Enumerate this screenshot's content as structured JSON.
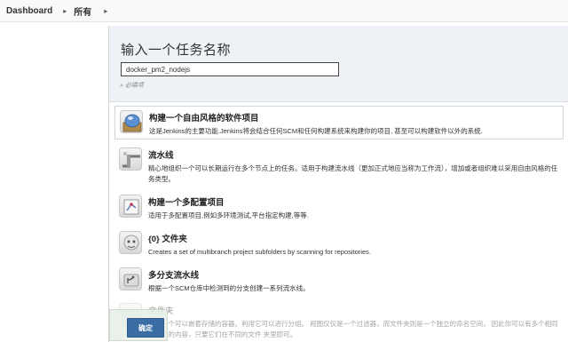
{
  "breadcrumb": {
    "items": [
      "Dashboard",
      "所有"
    ]
  },
  "form": {
    "title": "输入一个任务名称",
    "name_value": "docker_pm2_nodejs",
    "required_hint": "» 必填项"
  },
  "items": [
    {
      "title": "构建一个自由风格的软件项目",
      "desc": "这是Jenkins的主要功能.Jenkins将会结合任何SCM和任何构建系统来构建你的项目, 甚至可以构建软件以外的系统.",
      "icon": "freestyle-project-icon"
    },
    {
      "title": "流水线",
      "desc": "精心地组织一个可以长期运行在多个节点上的任务。适用于构建流水线（更加正式地应当称为工作流），增加或者组织难以采用自由风格的任务类型。",
      "icon": "pipeline-icon"
    },
    {
      "title": "构建一个多配置项目",
      "desc": "适用于多配置项目,例如多环境测试,平台指定构建,等等.",
      "icon": "multi-config-icon"
    },
    {
      "title": "{0} 文件夹",
      "desc": "Creates a set of multibranch project subfolders by scanning for repositories.",
      "icon": "org-folder-icon"
    },
    {
      "title": "多分支流水线",
      "desc": "根据一个SCM仓库中检测到的分支创建一系列流水线。",
      "icon": "multibranch-pipeline-icon"
    },
    {
      "title": "文件夹",
      "desc": "创建一个可以嵌套存储的容器。利用它可以进行分组。 视图仅仅是一个过滤器，而文件夹则是一个独立的命名空间， 因此你可以有多个相同名称的的内容，只要它们在不同的文件 夹里即可。",
      "icon": "folder-icon"
    }
  ],
  "footer": {
    "ok_label": "确定"
  }
}
